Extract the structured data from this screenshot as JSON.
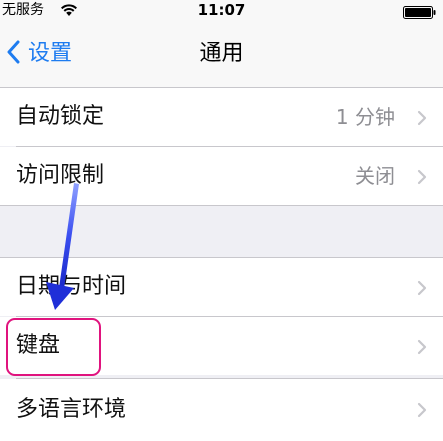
{
  "status_bar": {
    "carrier": "无服务",
    "time": "11:07",
    "wifi_icon": "wifi-icon",
    "battery_icon": "battery-icon"
  },
  "nav": {
    "back_label": "设置",
    "title": "通用",
    "back_icon": "chevron-left-icon"
  },
  "rows": [
    {
      "label": "自动锁定",
      "value": "1 分钟"
    },
    {
      "label": "访问限制",
      "value": "关闭"
    },
    {
      "label": "日期与时间",
      "value": ""
    },
    {
      "label": "键盘",
      "value": ""
    },
    {
      "label": "多语言环境",
      "value": ""
    }
  ],
  "colors": {
    "accent": "#1e7cf0",
    "background": "#efeff4",
    "highlight_border": "#e0137e",
    "annotation_arrow": "#2b3fe0"
  }
}
